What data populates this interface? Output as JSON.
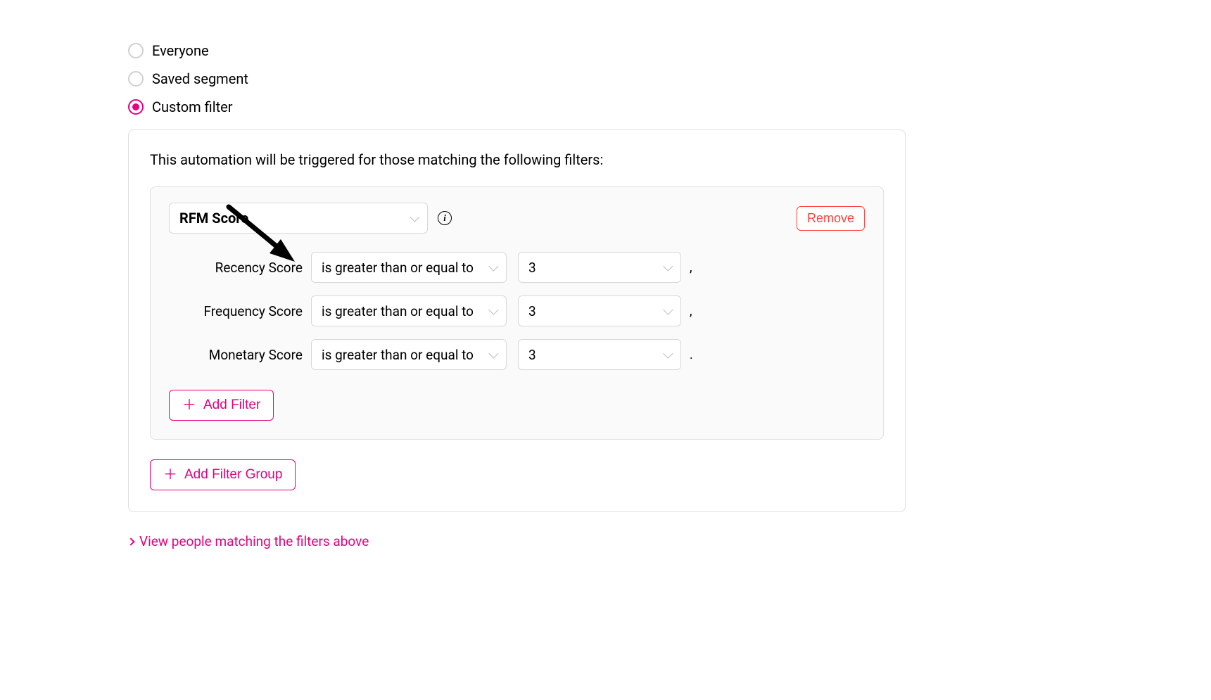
{
  "audience_options": {
    "everyone": "Everyone",
    "saved_segment": "Saved segment",
    "custom_filter": "Custom filter",
    "selected": "custom_filter"
  },
  "panel": {
    "description": "This automation will be triggered for those matching the following filters:"
  },
  "filter_group": {
    "filter_type": "RFM Score",
    "remove_label": "Remove",
    "rows": [
      {
        "label": "Recency Score",
        "operator": "is greater than or equal to",
        "value": "3",
        "trail": ","
      },
      {
        "label": "Frequency Score",
        "operator": "is greater than or equal to",
        "value": "3",
        "trail": ","
      },
      {
        "label": "Monetary Score",
        "operator": "is greater than or equal to",
        "value": "3",
        "trail": "."
      }
    ],
    "add_filter_label": "Add Filter"
  },
  "add_filter_group_label": "Add Filter Group",
  "view_people_label": "View people matching the filters above"
}
